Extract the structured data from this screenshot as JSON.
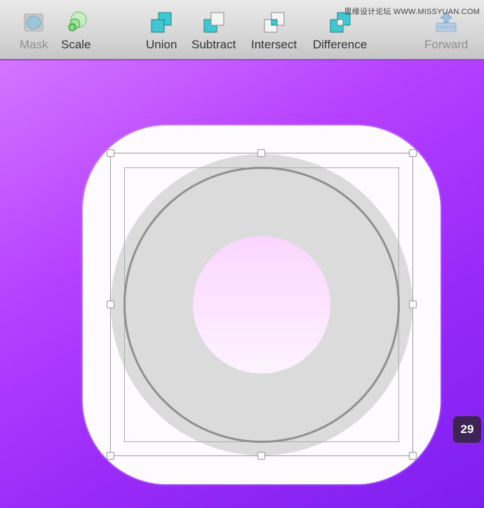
{
  "toolbar": {
    "mask_label": "Mask",
    "scale_label": "Scale",
    "union_label": "Union",
    "subtract_label": "Subtract",
    "intersect_label": "Intersect",
    "difference_label": "Difference",
    "forward_label": "Forward"
  },
  "icons": {
    "mask": "mask-icon",
    "scale": "scale-icon",
    "union": "union-icon",
    "subtract": "subtract-icon",
    "intersect": "intersect-icon",
    "difference": "difference-icon",
    "forward": "forward-icon"
  },
  "watermark": "思缘设计论坛 WWW.MISSYUAN.COM",
  "page_badge": "29",
  "colors": {
    "boolean_op_accent": "#3fc7d2",
    "canvas_gradient_start": "#d374ff",
    "canvas_gradient_end": "#7d1ff0",
    "icon_base": "#fefbff",
    "ring": "#dbdbdb",
    "core": "#fbd6ff"
  }
}
